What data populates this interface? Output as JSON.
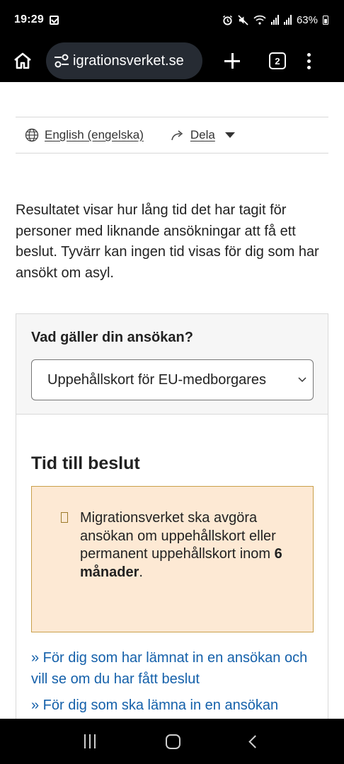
{
  "status_bar": {
    "time": "19:29",
    "battery": "63%"
  },
  "browser": {
    "url": "igrationsverket.se",
    "tab_count": "2"
  },
  "utility": {
    "language_link": "English (engelska)",
    "share_link": "Dela"
  },
  "intro_text": "Resultatet visar hur lång tid det har tagit för personer med liknande ansökningar att få ett beslut. Tyvärr kan ingen tid visas för dig som har ansökt om asyl.",
  "selector": {
    "label": "Vad gäller din ansökan?",
    "selected_value": "Uppehållskort för EU-medborgares"
  },
  "result": {
    "title": "Tid till beslut",
    "notice_text": "Migrationsverket ska avgöra ansökan om uppehållskort eller permanent uppehållskort inom ",
    "notice_bold": "6 månader",
    "notice_end": "."
  },
  "links": [
    "» För dig som har lämnat in en ansökan och vill se om du har fått beslut",
    "» För dig som ska lämna in en ansökan"
  ],
  "icons": {
    "home": "home-icon",
    "site_settings": "tune-icon",
    "new_tab": "plus-icon",
    "menu": "more-vert-icon",
    "globe": "globe-icon",
    "share": "share-arrow-icon"
  }
}
